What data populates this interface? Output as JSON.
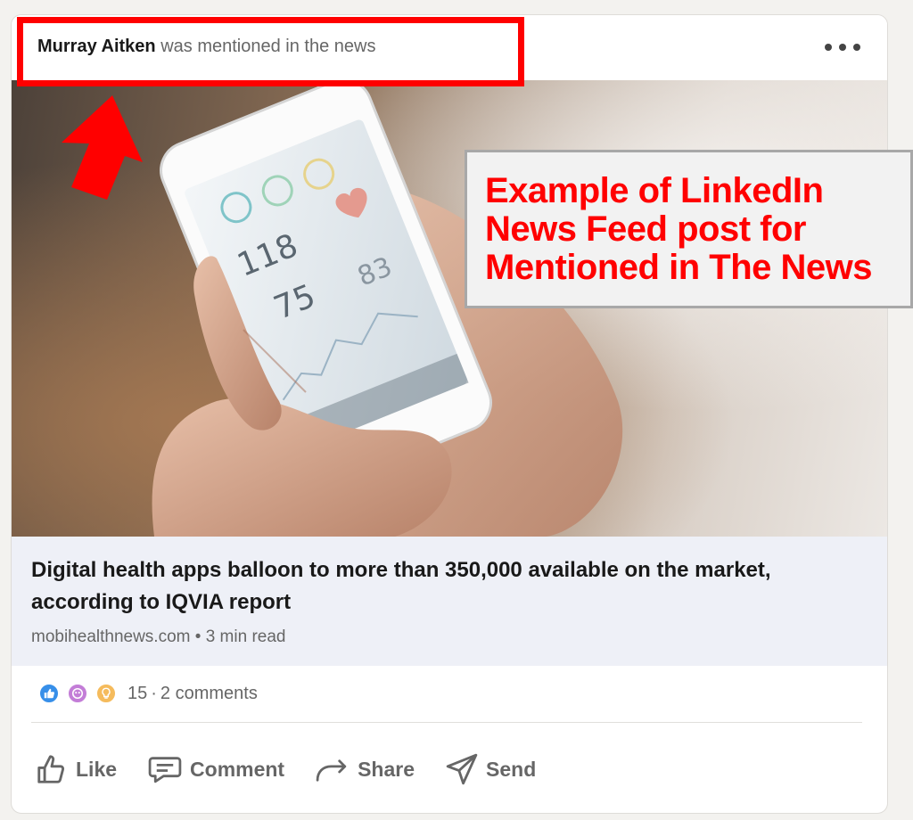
{
  "post": {
    "header": {
      "actor_name": "Murray Aitken",
      "action_text": "was mentioned in the news"
    },
    "annotation": {
      "callout_text": "Example of LinkedIn News Feed post for Mentioned in The News",
      "highlight_color": "#ff0000"
    },
    "image": {
      "phone_readings": [
        "118",
        "75",
        "83"
      ]
    },
    "article": {
      "title": "Digital health apps balloon to more than 350,000 available on the market, according to IQVIA report",
      "source": "mobihealthnews.com",
      "separator": "•",
      "read_time": "3 min read"
    },
    "social": {
      "reactions": [
        "like",
        "celebrate",
        "insightful"
      ],
      "reaction_count": "15",
      "separator": "·",
      "comments": "2 comments"
    },
    "actions": [
      {
        "label": "Like",
        "icon": "like-icon"
      },
      {
        "label": "Comment",
        "icon": "comment-icon"
      },
      {
        "label": "Share",
        "icon": "share-icon"
      },
      {
        "label": "Send",
        "icon": "send-icon"
      }
    ],
    "colors": {
      "accent_red": "#ff0000",
      "like_blue": "#378fe9",
      "celebrate_purple": "#c37dd7",
      "insightful_yellow": "#f5bb5c",
      "text_secondary": "#666666",
      "meta_background": "#eef0f7"
    }
  }
}
